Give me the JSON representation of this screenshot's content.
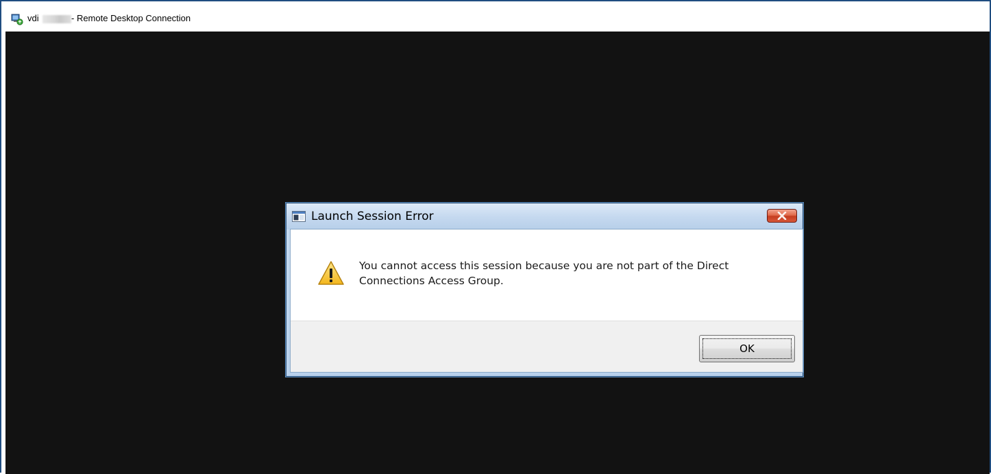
{
  "rdp_window": {
    "title_prefix": "vdi",
    "title_suffix": "- Remote Desktop Connection",
    "app_icon": "remote-desktop-icon"
  },
  "dialog": {
    "title": "Launch Session Error",
    "title_icon": "application-window-icon",
    "close_icon": "close-icon",
    "message_icon": "warning-icon",
    "message": "You cannot access this session because you are not part of the Direct Connections Access Group.",
    "ok_label": "OK"
  },
  "colors": {
    "remote_background": "#121212",
    "close_button": "#c53d20",
    "dialog_frame": "#b9d1ec"
  }
}
